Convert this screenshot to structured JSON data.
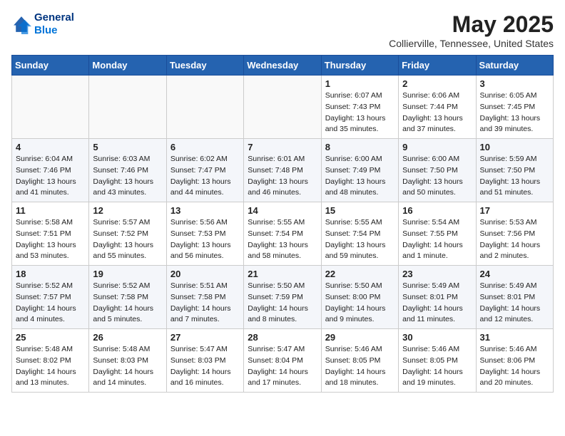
{
  "header": {
    "logo_line1": "General",
    "logo_line2": "Blue",
    "month": "May 2025",
    "location": "Collierville, Tennessee, United States"
  },
  "weekdays": [
    "Sunday",
    "Monday",
    "Tuesday",
    "Wednesday",
    "Thursday",
    "Friday",
    "Saturday"
  ],
  "weeks": [
    [
      {
        "day": "",
        "info": ""
      },
      {
        "day": "",
        "info": ""
      },
      {
        "day": "",
        "info": ""
      },
      {
        "day": "",
        "info": ""
      },
      {
        "day": "1",
        "info": "Sunrise: 6:07 AM\nSunset: 7:43 PM\nDaylight: 13 hours\nand 35 minutes."
      },
      {
        "day": "2",
        "info": "Sunrise: 6:06 AM\nSunset: 7:44 PM\nDaylight: 13 hours\nand 37 minutes."
      },
      {
        "day": "3",
        "info": "Sunrise: 6:05 AM\nSunset: 7:45 PM\nDaylight: 13 hours\nand 39 minutes."
      }
    ],
    [
      {
        "day": "4",
        "info": "Sunrise: 6:04 AM\nSunset: 7:46 PM\nDaylight: 13 hours\nand 41 minutes."
      },
      {
        "day": "5",
        "info": "Sunrise: 6:03 AM\nSunset: 7:46 PM\nDaylight: 13 hours\nand 43 minutes."
      },
      {
        "day": "6",
        "info": "Sunrise: 6:02 AM\nSunset: 7:47 PM\nDaylight: 13 hours\nand 44 minutes."
      },
      {
        "day": "7",
        "info": "Sunrise: 6:01 AM\nSunset: 7:48 PM\nDaylight: 13 hours\nand 46 minutes."
      },
      {
        "day": "8",
        "info": "Sunrise: 6:00 AM\nSunset: 7:49 PM\nDaylight: 13 hours\nand 48 minutes."
      },
      {
        "day": "9",
        "info": "Sunrise: 6:00 AM\nSunset: 7:50 PM\nDaylight: 13 hours\nand 50 minutes."
      },
      {
        "day": "10",
        "info": "Sunrise: 5:59 AM\nSunset: 7:50 PM\nDaylight: 13 hours\nand 51 minutes."
      }
    ],
    [
      {
        "day": "11",
        "info": "Sunrise: 5:58 AM\nSunset: 7:51 PM\nDaylight: 13 hours\nand 53 minutes."
      },
      {
        "day": "12",
        "info": "Sunrise: 5:57 AM\nSunset: 7:52 PM\nDaylight: 13 hours\nand 55 minutes."
      },
      {
        "day": "13",
        "info": "Sunrise: 5:56 AM\nSunset: 7:53 PM\nDaylight: 13 hours\nand 56 minutes."
      },
      {
        "day": "14",
        "info": "Sunrise: 5:55 AM\nSunset: 7:54 PM\nDaylight: 13 hours\nand 58 minutes."
      },
      {
        "day": "15",
        "info": "Sunrise: 5:55 AM\nSunset: 7:54 PM\nDaylight: 13 hours\nand 59 minutes."
      },
      {
        "day": "16",
        "info": "Sunrise: 5:54 AM\nSunset: 7:55 PM\nDaylight: 14 hours\nand 1 minute."
      },
      {
        "day": "17",
        "info": "Sunrise: 5:53 AM\nSunset: 7:56 PM\nDaylight: 14 hours\nand 2 minutes."
      }
    ],
    [
      {
        "day": "18",
        "info": "Sunrise: 5:52 AM\nSunset: 7:57 PM\nDaylight: 14 hours\nand 4 minutes."
      },
      {
        "day": "19",
        "info": "Sunrise: 5:52 AM\nSunset: 7:58 PM\nDaylight: 14 hours\nand 5 minutes."
      },
      {
        "day": "20",
        "info": "Sunrise: 5:51 AM\nSunset: 7:58 PM\nDaylight: 14 hours\nand 7 minutes."
      },
      {
        "day": "21",
        "info": "Sunrise: 5:50 AM\nSunset: 7:59 PM\nDaylight: 14 hours\nand 8 minutes."
      },
      {
        "day": "22",
        "info": "Sunrise: 5:50 AM\nSunset: 8:00 PM\nDaylight: 14 hours\nand 9 minutes."
      },
      {
        "day": "23",
        "info": "Sunrise: 5:49 AM\nSunset: 8:01 PM\nDaylight: 14 hours\nand 11 minutes."
      },
      {
        "day": "24",
        "info": "Sunrise: 5:49 AM\nSunset: 8:01 PM\nDaylight: 14 hours\nand 12 minutes."
      }
    ],
    [
      {
        "day": "25",
        "info": "Sunrise: 5:48 AM\nSunset: 8:02 PM\nDaylight: 14 hours\nand 13 minutes."
      },
      {
        "day": "26",
        "info": "Sunrise: 5:48 AM\nSunset: 8:03 PM\nDaylight: 14 hours\nand 14 minutes."
      },
      {
        "day": "27",
        "info": "Sunrise: 5:47 AM\nSunset: 8:03 PM\nDaylight: 14 hours\nand 16 minutes."
      },
      {
        "day": "28",
        "info": "Sunrise: 5:47 AM\nSunset: 8:04 PM\nDaylight: 14 hours\nand 17 minutes."
      },
      {
        "day": "29",
        "info": "Sunrise: 5:46 AM\nSunset: 8:05 PM\nDaylight: 14 hours\nand 18 minutes."
      },
      {
        "day": "30",
        "info": "Sunrise: 5:46 AM\nSunset: 8:05 PM\nDaylight: 14 hours\nand 19 minutes."
      },
      {
        "day": "31",
        "info": "Sunrise: 5:46 AM\nSunset: 8:06 PM\nDaylight: 14 hours\nand 20 minutes."
      }
    ]
  ]
}
